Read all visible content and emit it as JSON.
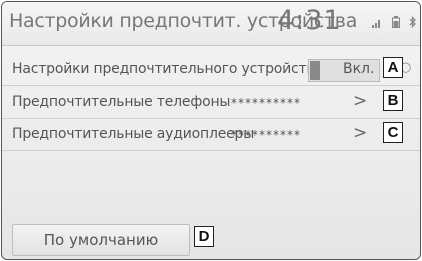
{
  "header": {
    "title": "Настройки предпочтит. устройства",
    "clock": "4:31"
  },
  "rows": [
    {
      "label": "Настройки предпочтительного устройства",
      "toggle_text": "Вкл.",
      "callout": "A"
    },
    {
      "label": "Предпочтительные телефоны",
      "value": "**********",
      "chevron": ">",
      "callout": "B"
    },
    {
      "label": "Предпочтительные аудиоплееры",
      "value": "**********",
      "chevron": ">",
      "callout": "C"
    }
  ],
  "footer": {
    "default_button": "По умолчанию",
    "callout": "D"
  },
  "icons": [
    "signal-icon",
    "battery-icon",
    "bluetooth-icon"
  ]
}
